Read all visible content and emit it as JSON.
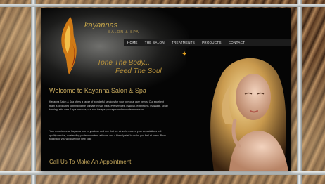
{
  "brand": {
    "name": "kayannas",
    "sub": "SALON & SPA"
  },
  "nav": [
    {
      "label": "HOME",
      "active": true
    },
    {
      "label": "THE SALON",
      "active": false
    },
    {
      "label": "TREATMENTS",
      "active": false
    },
    {
      "label": "PRODUCTS",
      "active": false
    },
    {
      "label": "CONTACT",
      "active": false
    }
  ],
  "tagline": {
    "line1": "Tone The Body...",
    "line2": "Feed The Soul"
  },
  "welcome": "Welcome to Kayanna Salon & Spa",
  "paragraphs": [
    "Kayanna Salon & Spa offers a range of wonderful services for your personal care needs. Our excellent team is dedicated to bringing the ultimate in hair, nails, eye services, makeup, extensions, massage, spray tanning, skin care & spa services, our and the spa packages and microdermabrasion.",
    "Your experience at Kayanna is a very unique and one that we strive to exceed your expectations with quality service, outstanding professionalism, attitude, and a friendly staff to make you feel at home. Book today and you will love your new look!"
  ],
  "call": "Call Us To Make An Appointment",
  "colors": {
    "gold": "#c9ab5e",
    "accent": "#e7a320",
    "bg": "#050505"
  },
  "icons": {
    "logo": "flame-logo-icon",
    "bird": "bird-icon"
  }
}
